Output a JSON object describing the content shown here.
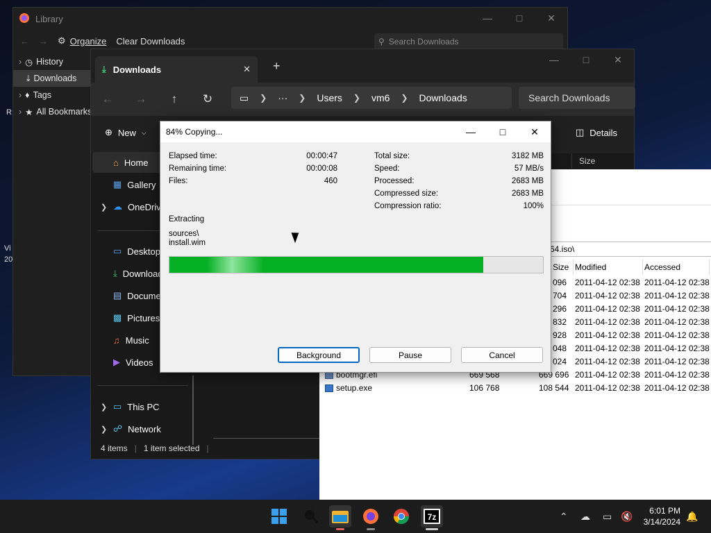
{
  "desktop": {
    "label1": "R",
    "label2": "Vi",
    "label3": "20"
  },
  "library": {
    "title": "Library",
    "organize": "Organize",
    "clear_downloads": "Clear Downloads",
    "search_placeholder": "Search Downloads",
    "tree": [
      {
        "label": "History",
        "icon": "clock-icon"
      },
      {
        "label": "Downloads",
        "icon": "download-icon",
        "selected": true
      },
      {
        "label": "Tags",
        "icon": "tag-icon"
      },
      {
        "label": "All Bookmarks",
        "icon": "star-icon"
      }
    ]
  },
  "explorer": {
    "tab_title": "Downloads",
    "breadcrumb": [
      "Users",
      "vm6",
      "Downloads"
    ],
    "search_placeholder": "Search Downloads",
    "new_label": "New",
    "details_label": "Details",
    "size_column": "Size",
    "nav": [
      {
        "label": "Home",
        "icon": "home-icon",
        "selected": true
      },
      {
        "label": "Gallery",
        "icon": "gallery-icon"
      },
      {
        "label": "OneDrive",
        "icon": "cloud-icon",
        "expandable": true
      },
      {
        "label": "Desktop",
        "icon": "desktop-icon"
      },
      {
        "label": "Downloads",
        "icon": "download-icon"
      },
      {
        "label": "Documents",
        "icon": "documents-icon"
      },
      {
        "label": "Pictures",
        "icon": "pictures-icon"
      },
      {
        "label": "Music",
        "icon": "music-icon"
      },
      {
        "label": "Videos",
        "icon": "videos-icon"
      },
      {
        "label": "This PC",
        "icon": "pc-icon",
        "expandable": true
      },
      {
        "label": "Network",
        "icon": "network-icon",
        "expandable": true
      }
    ],
    "status_items": "4 items",
    "status_selected": "1 item selected"
  },
  "sevenzip": {
    "path_suffix": "64.iso\\",
    "columns": {
      "size": "Size",
      "modified": "Modified",
      "accessed": "Accessed"
    },
    "partial_rows": [
      {
        "size": "096",
        "modified": "2011-04-12 02:38",
        "accessed": "2011-04-12 02:38"
      },
      {
        "size": "704",
        "modified": "2011-04-12 02:38",
        "accessed": "2011-04-12 02:38"
      },
      {
        "size": "296",
        "modified": "2011-04-12 02:38",
        "accessed": "2011-04-12 02:38"
      },
      {
        "size": "832",
        "modified": "2011-04-12 02:38",
        "accessed": "2011-04-12 02:38"
      },
      {
        "size": "928",
        "modified": "2011-04-12 02:38",
        "accessed": "2011-04-12 02:38"
      },
      {
        "size": "048",
        "modified": "2011-04-12 02:38",
        "accessed": "2011-04-12 02:38"
      },
      {
        "size": "024",
        "modified": "2011-04-12 02:38",
        "accessed": "2011-04-12 02:38"
      }
    ],
    "full_rows": [
      {
        "name": "bootmgr.efi",
        "size": "669 568",
        "packed": "669 696",
        "modified": "2011-04-12 02:38",
        "accessed": "2011-04-12 02:38"
      },
      {
        "name": "setup.exe",
        "size": "106 768",
        "packed": "108 544",
        "modified": "2011-04-12 02:38",
        "accessed": "2011-04-12 02:38"
      }
    ]
  },
  "dialog": {
    "title": "84% Copying...",
    "progress_percent": 84,
    "left": [
      {
        "label": "Elapsed time:",
        "value": "00:00:47"
      },
      {
        "label": "Remaining time:",
        "value": "00:00:08"
      },
      {
        "label": "Files:",
        "value": "460"
      }
    ],
    "right": [
      {
        "label": "Total size:",
        "value": "3182 MB"
      },
      {
        "label": "Speed:",
        "value": "57 MB/s"
      },
      {
        "label": "Processed:",
        "value": "2683 MB"
      },
      {
        "label": "Compressed size:",
        "value": "2683 MB"
      },
      {
        "label": "Compression ratio:",
        "value": "100%"
      }
    ],
    "operation": "Extracting",
    "current_path": "sources\\",
    "current_file": "install.wim",
    "buttons": {
      "background": "Background",
      "pause": "Pause",
      "cancel": "Cancel"
    }
  },
  "taskbar": {
    "time": "6:01 PM",
    "date": "3/14/2024",
    "apps": [
      "windows-start-icon",
      "search-icon",
      "file-explorer-icon",
      "firefox-icon",
      "chrome-icon",
      "7zip-icon"
    ]
  },
  "colors": {
    "progress_green": "#06b025",
    "accent_blue": "#0067c0"
  }
}
